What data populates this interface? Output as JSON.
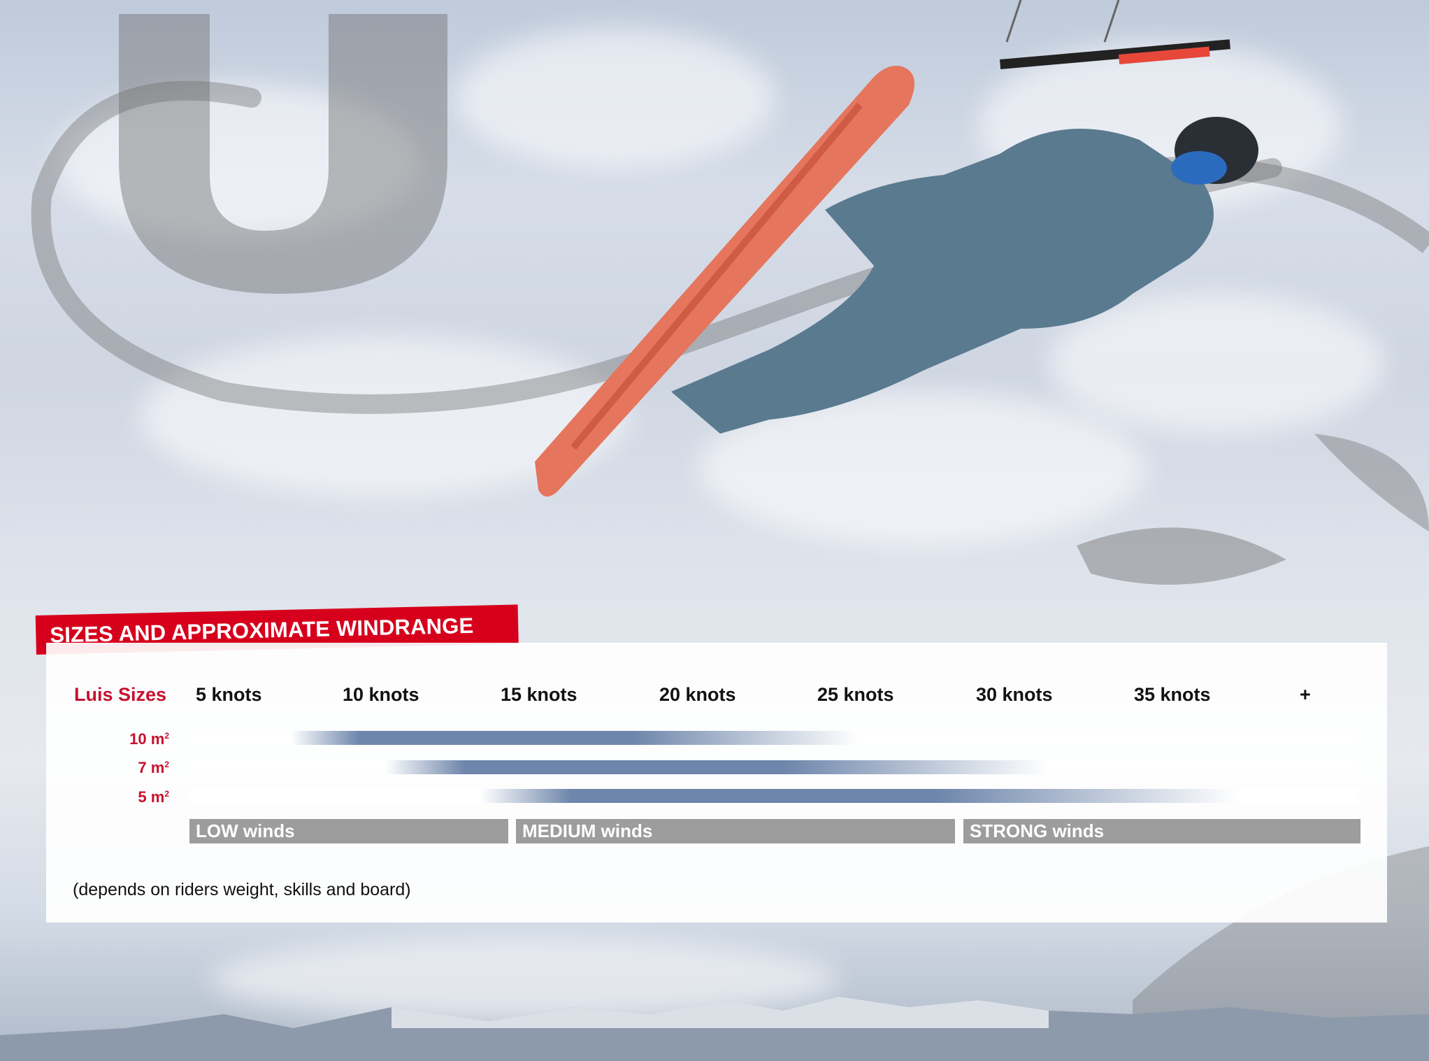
{
  "banner": {
    "title": "SIZES AND APPROXIMATE WINDRANGE"
  },
  "table": {
    "row_header": "Luis Sizes",
    "columns": [
      "5 knots",
      "10 knots",
      "15 knots",
      "20 knots",
      "25 knots",
      "30 knots",
      "35 knots",
      "+"
    ],
    "rows": [
      {
        "label": "10 m",
        "exp": "2",
        "from_knots": 8,
        "to_knots": 26
      },
      {
        "label": "7 m",
        "exp": "2",
        "from_knots": 11,
        "to_knots": 32
      },
      {
        "label": "5 m",
        "exp": "2",
        "from_knots": 14,
        "to_knots": 38
      }
    ],
    "categories": [
      "LOW winds",
      "MEDIUM winds",
      "STRONG winds"
    ],
    "note": "(depends on riders weight, skills and board)"
  },
  "colors": {
    "accent": "#d6001c",
    "bar": "#6e86ab",
    "category": "#9d9d9d"
  }
}
